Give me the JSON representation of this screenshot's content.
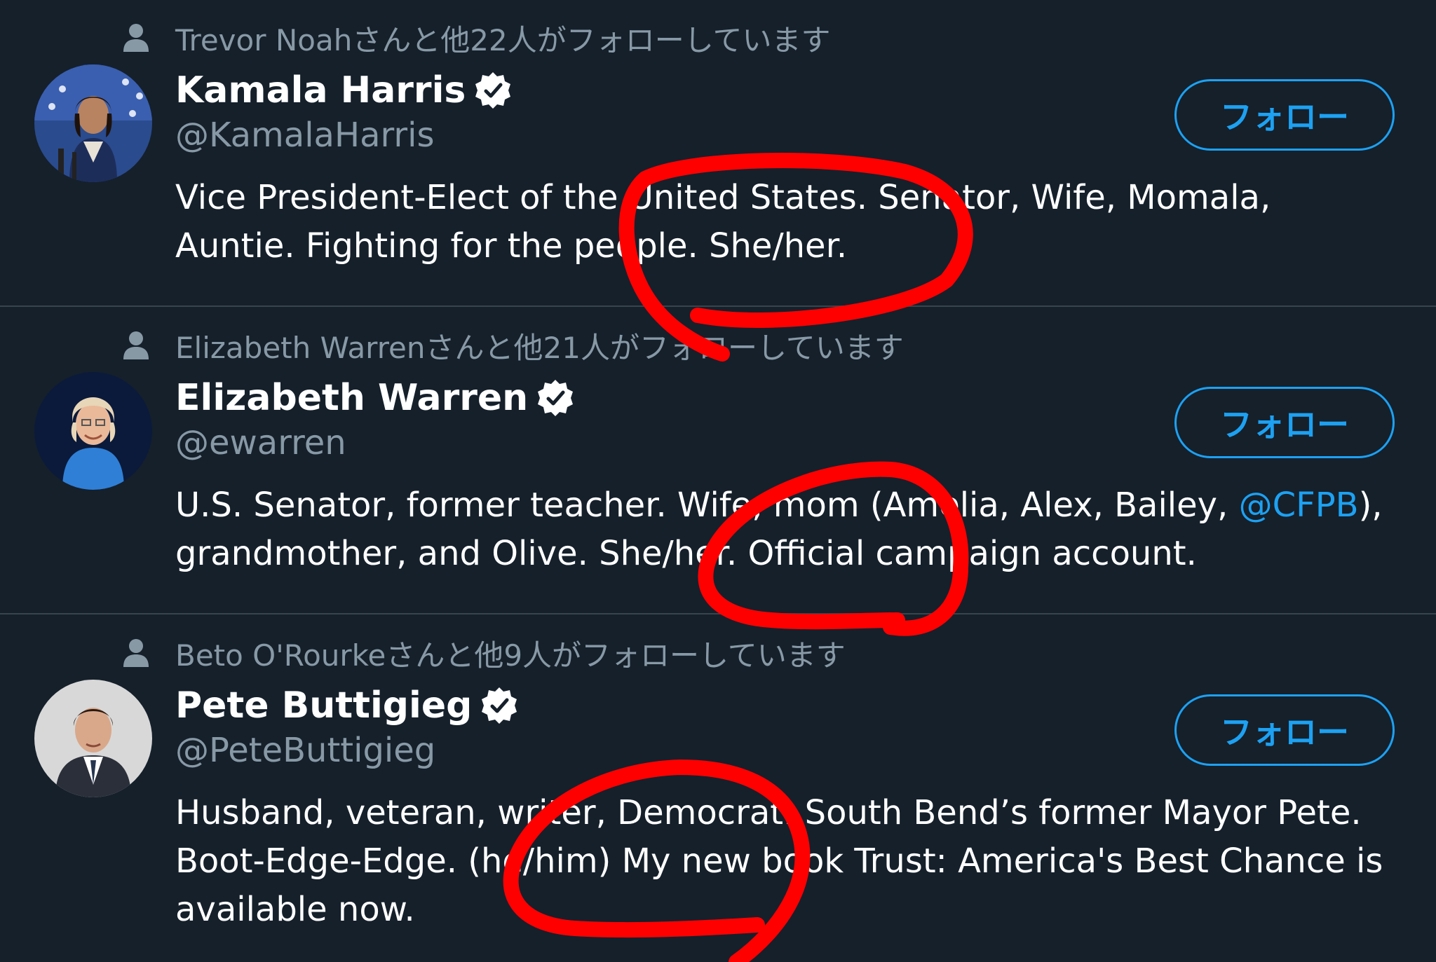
{
  "accent_color": "#1da1f2",
  "background_color": "#15202b",
  "annotation_color": "#ff0000",
  "cards": [
    {
      "social_context": "Trevor Noahさんと他22人がフォローしています",
      "name": "Kamala Harris",
      "handle": "@KamalaHarris",
      "bio": "Vice President-Elect of the United States. Senator, Wife, Momala, Auntie. Fighting for the people. She/her.",
      "follow_label": "フォロー",
      "verified": true
    },
    {
      "social_context": "Elizabeth Warrenさんと他21人がフォローしています",
      "name": "Elizabeth Warren",
      "handle": "@ewarren",
      "bio_before": "U.S. Senator, former teacher. Wife, mom (Amelia, Alex, Bailey, ",
      "bio_mention": "@CFPB",
      "bio_after": "), grandmother, and Olive. She/her. Official campaign account.",
      "follow_label": "フォロー",
      "verified": true
    },
    {
      "social_context": "Beto O'Rourkeさんと他9人がフォローしています",
      "name": "Pete Buttigieg",
      "handle": "@PeteButtigieg",
      "bio": "Husband, veteran, writer, Democrat. South Bend’s former Mayor Pete. Boot-Edge-Edge. (he/him) My new book Trust: America's Best Chance is available now.",
      "follow_label": "フォロー",
      "verified": true
    }
  ],
  "icons": {
    "social": "person-icon",
    "verified": "verified-badge-icon"
  }
}
